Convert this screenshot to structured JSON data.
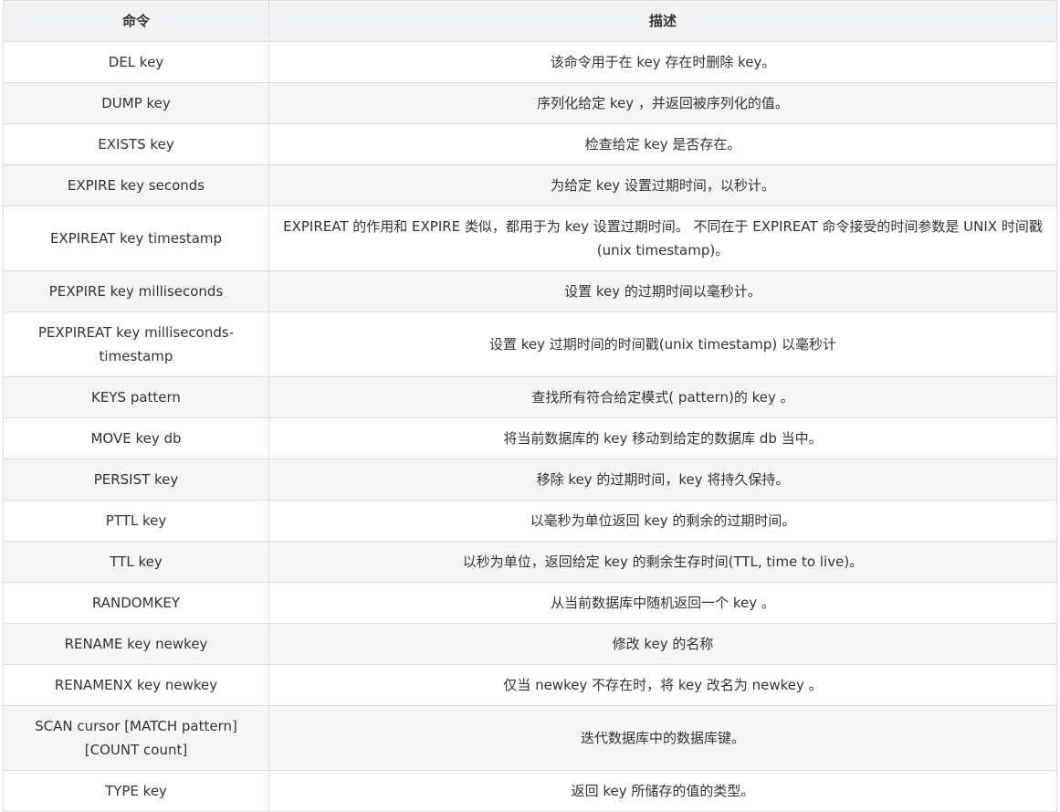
{
  "table": {
    "headers": [
      "命令",
      "描述"
    ],
    "rows": [
      {
        "command": "DEL key",
        "description": "该命令用于在 key 存在时删除 key。"
      },
      {
        "command": "DUMP key",
        "description": "序列化给定 key ，并返回被序列化的值。"
      },
      {
        "command": "EXISTS key",
        "description": "检查给定 key 是否存在。"
      },
      {
        "command": "EXPIRE key seconds",
        "description": "为给定 key 设置过期时间，以秒计。"
      },
      {
        "command": "EXPIREAT key timestamp",
        "description": "EXPIREAT 的作用和 EXPIRE 类似，都用于为 key 设置过期时间。 不同在于 EXPIREAT 命令接受的时间参数是 UNIX 时间戳(unix timestamp)。"
      },
      {
        "command": "PEXPIRE key milliseconds",
        "description": "设置 key 的过期时间以毫秒计。"
      },
      {
        "command": "PEXPIREAT key milliseconds-timestamp",
        "description": "设置 key 过期时间的时间戳(unix timestamp) 以毫秒计"
      },
      {
        "command": "KEYS pattern",
        "description": "查找所有符合给定模式( pattern)的 key 。"
      },
      {
        "command": "MOVE key db",
        "description": "将当前数据库的 key 移动到给定的数据库 db 当中。"
      },
      {
        "command": "PERSIST key",
        "description": "移除 key 的过期时间，key 将持久保持。"
      },
      {
        "command": "PTTL key",
        "description": "以毫秒为单位返回 key 的剩余的过期时间。"
      },
      {
        "command": "TTL key",
        "description": "以秒为单位，返回给定 key 的剩余生存时间(TTL, time to live)。"
      },
      {
        "command": "RANDOMKEY",
        "description": "从当前数据库中随机返回一个 key 。"
      },
      {
        "command": "RENAME key newkey",
        "description": "修改 key 的名称"
      },
      {
        "command": "RENAMENX key newkey",
        "description": "仅当 newkey 不存在时，将 key 改名为 newkey 。"
      },
      {
        "command": "SCAN cursor [MATCH pattern] [COUNT count]",
        "description": "迭代数据库中的数据库键。"
      },
      {
        "command": "TYPE key",
        "description": "返回 key 所储存的值的类型。"
      }
    ]
  }
}
